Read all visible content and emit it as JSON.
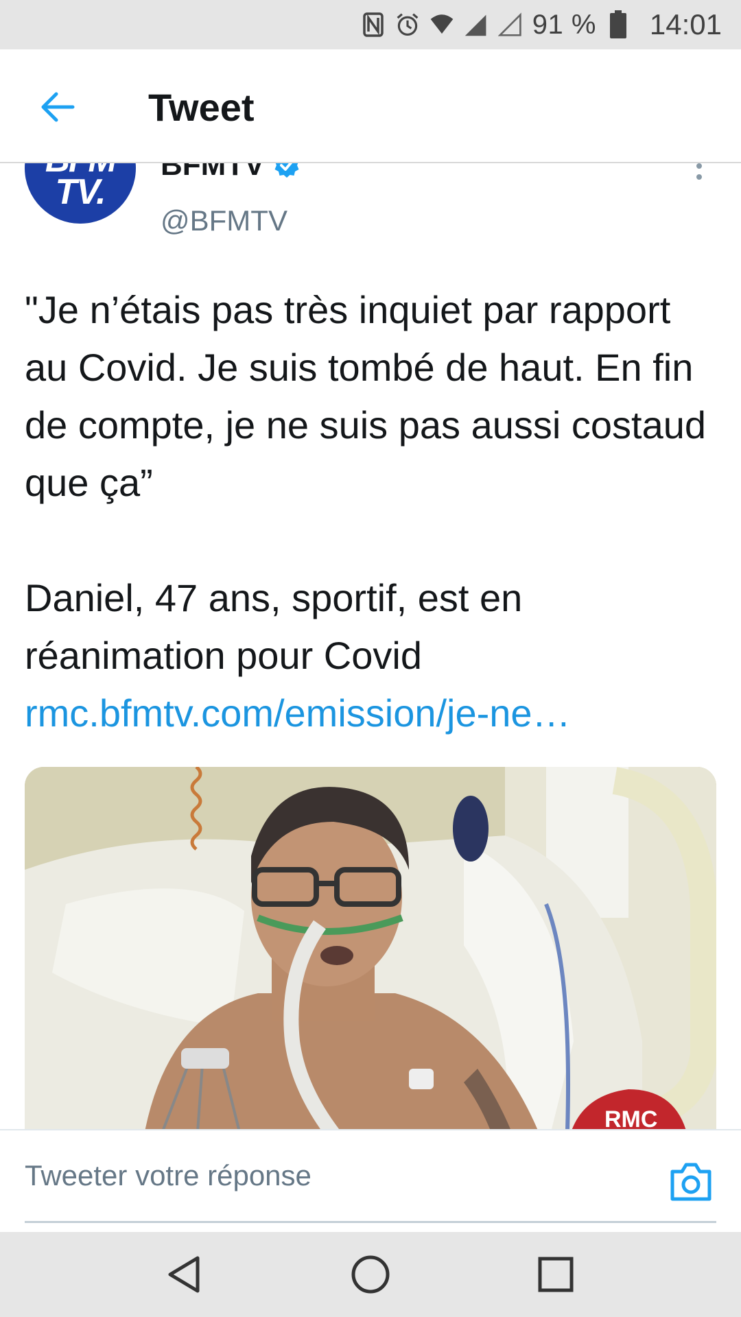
{
  "status_bar": {
    "battery_percent": "91 %",
    "time": "14:01",
    "icons": [
      "nfc-icon",
      "alarm-icon",
      "wifi-icon",
      "signal-icon",
      "signal-empty-icon",
      "battery-icon"
    ]
  },
  "header": {
    "title": "Tweet",
    "back_icon": "back-arrow-icon"
  },
  "tweet": {
    "author": {
      "name": "BFMTV",
      "handle": "@BFMTV",
      "verified": true,
      "avatar_text_line1": "BFM",
      "avatar_text_line2": "TV."
    },
    "text_paragraph_1": "\"Je n’étais pas très inquiet par rapport au Covid. Je suis tombé de haut. En fin de compte, je ne suis pas aussi costaud que ça”",
    "text_paragraph_2": "Daniel, 47 ans, sportif, est en réanimation pour Covid",
    "link": "rmc.bfmtv.com/emission/je-ne…",
    "media": {
      "mic_label": "RMC"
    }
  },
  "reply": {
    "placeholder": "Tweeter votre réponse",
    "camera_icon": "camera-icon"
  },
  "nav": {
    "back": "nav-back-icon",
    "home": "nav-home-icon",
    "recent": "nav-recent-icon"
  },
  "colors": {
    "accent": "#1da1f2",
    "link": "#1b95e0",
    "avatar_bg": "#1c3fa6",
    "secondary_text": "#657786"
  }
}
